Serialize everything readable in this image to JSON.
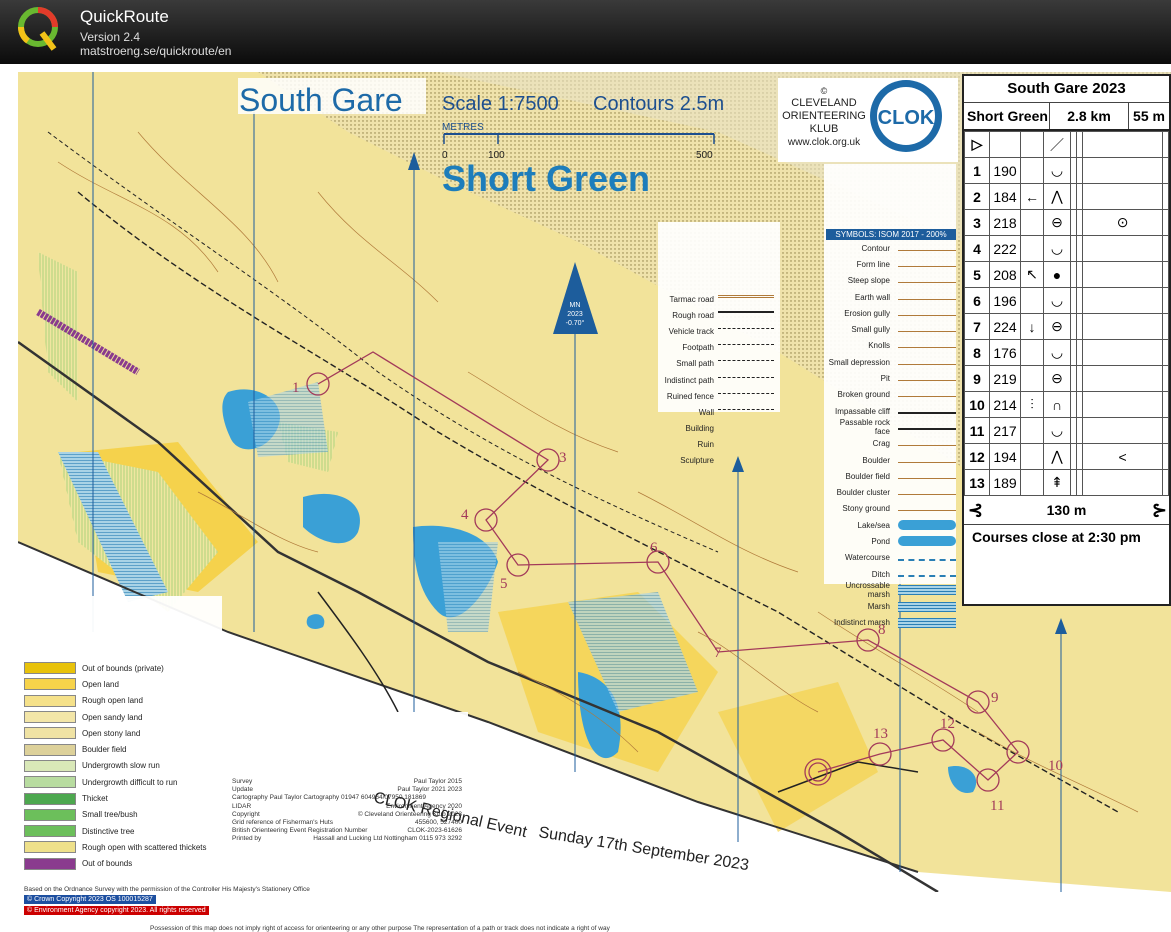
{
  "app": {
    "name": "QuickRoute",
    "version": "Version 2.4",
    "url": "matstroeng.se/quickroute/en"
  },
  "map": {
    "title": "South Gare",
    "scale": "Scale 1:7500",
    "contours": "Contours 2.5m",
    "metres_label": "METRES",
    "scale_ticks": [
      "0",
      "100",
      "500"
    ],
    "course_name": "Short Green",
    "club_copyright": "©",
    "club_lines": [
      "CLEVELAND",
      "ORIENTEERING",
      "KLUB"
    ],
    "club_url": "www.clok.org.uk",
    "club_logo": "CLOK",
    "north_label": [
      "MN",
      "2023",
      "-0.70°"
    ],
    "event_name": "CLOK Regional Event",
    "event_date": "Sunday 17th September 2023",
    "course_controls": [
      "1",
      "3",
      "4",
      "5",
      "6",
      "7",
      "8",
      "9",
      "10",
      "11",
      "12",
      "13"
    ]
  },
  "control_card": {
    "title": "South Gare 2023",
    "course": "Short Green",
    "length": "2.8 km",
    "climb": "55 m",
    "rows": [
      {
        "num": "1",
        "code": "190",
        "dir": "",
        "feat": "◡",
        "extra": ""
      },
      {
        "num": "2",
        "code": "184",
        "dir": "←",
        "feat": "⋀",
        "extra": ""
      },
      {
        "num": "3",
        "code": "218",
        "dir": "",
        "feat": "⊖",
        "extra": "⊙"
      },
      {
        "num": "4",
        "code": "222",
        "dir": "",
        "feat": "◡",
        "extra": ""
      },
      {
        "num": "5",
        "code": "208",
        "dir": "↖",
        "feat": "●",
        "extra": ""
      },
      {
        "num": "6",
        "code": "196",
        "dir": "",
        "feat": "◡",
        "extra": ""
      },
      {
        "num": "7",
        "code": "224",
        "dir": "↓",
        "feat": "⊖",
        "extra": ""
      },
      {
        "num": "8",
        "code": "176",
        "dir": "",
        "feat": "◡",
        "extra": ""
      },
      {
        "num": "9",
        "code": "219",
        "dir": "",
        "feat": "⊖",
        "extra": ""
      },
      {
        "num": "10",
        "code": "214",
        "dir": "⫶",
        "feat": "∩",
        "extra": ""
      },
      {
        "num": "11",
        "code": "217",
        "dir": "",
        "feat": "◡",
        "extra": ""
      },
      {
        "num": "12",
        "code": "194",
        "dir": "",
        "feat": "⋀",
        "extra": "<"
      },
      {
        "num": "13",
        "code": "189",
        "dir": "",
        "feat": "⇞",
        "extra": ""
      }
    ],
    "finish": "130 m",
    "close": "Courses close at 2:30 pm"
  },
  "legend_left": [
    {
      "label": "Out of bounds (private)",
      "color": "#e8c20a"
    },
    {
      "label": "Open land",
      "color": "#f7d34a"
    },
    {
      "label": "Rough open land",
      "color": "#f5e18a"
    },
    {
      "label": "Open sandy land",
      "color": "#f3e6a8"
    },
    {
      "label": "Open stony land",
      "color": "#f0e3a4"
    },
    {
      "label": "Boulder field",
      "color": "#ddd19a"
    },
    {
      "label": "Undergrowth slow run",
      "color": "#d9e8b8"
    },
    {
      "label": "Undergrowth difficult to run",
      "color": "#b8dca0"
    },
    {
      "label": "Thicket",
      "color": "#4da84f"
    },
    {
      "label": "Small tree/bush",
      "color": "#6cbf5b"
    },
    {
      "label": "Distinctive tree",
      "color": "#6cbf5b"
    },
    {
      "label": "Rough open with scattered thickets",
      "color": "#eee08a"
    },
    {
      "label": "Out of bounds",
      "color": "#8a3b8e"
    }
  ],
  "symbols_header": "SYMBOLS: ISOM 2017 - 200%",
  "symbols": [
    "Contour",
    "Form line",
    "Steep slope",
    "Earth wall",
    "Erosion gully",
    "Small gully",
    "Knolls",
    "Small depression",
    "Pit",
    "Broken ground",
    "Impassable cliff",
    "Passable rock face",
    "Crag",
    "Boulder",
    "Boulder field",
    "Boulder cluster",
    "Stony ground",
    "Lake/sea",
    "Pond",
    "Watercourse",
    "Ditch",
    "Uncrossable marsh",
    "Marsh",
    "Indistinct marsh"
  ],
  "paths": [
    "Tarmac road",
    "Rough road",
    "Vehicle track",
    "Footpath",
    "Small path",
    "Indistinct path",
    "Ruined fence",
    "Wall",
    "Building",
    "Ruin",
    "Sculpture"
  ],
  "credits": [
    [
      "Survey",
      "Paul Taylor 2015"
    ],
    [
      "Update",
      "Paul Taylor 2021 2023"
    ],
    [
      "Cartography  Paul Taylor Cartography  01947 604964/07950 181869",
      ""
    ],
    [
      "LIDAR",
      "Environment Agency 2020"
    ],
    [
      "Copyright",
      "© Cleveland Orienteering Klub 2023"
    ],
    [
      "Grid reference of Fisherman's Huts",
      "455600, 527400"
    ],
    [
      "British Orienteering Event Registration Number",
      "CLOK-2023-61626"
    ],
    [
      "Printed by",
      "Hassall and Lucking Ltd  Nottingham  0115 973 3292"
    ]
  ],
  "ordnance": "Based on the Ordnance Survey with the permission of the Controller His Majesty's Stationery Office",
  "crown": "© Crown Copyright 2023 OS 100015287",
  "environment": "© Environment Agency copyright 2023. All rights reserved",
  "possession": "Possession of this map does not imply right of access for orienteering or any other purpose  The representation of a path or track does not indicate a right of way"
}
